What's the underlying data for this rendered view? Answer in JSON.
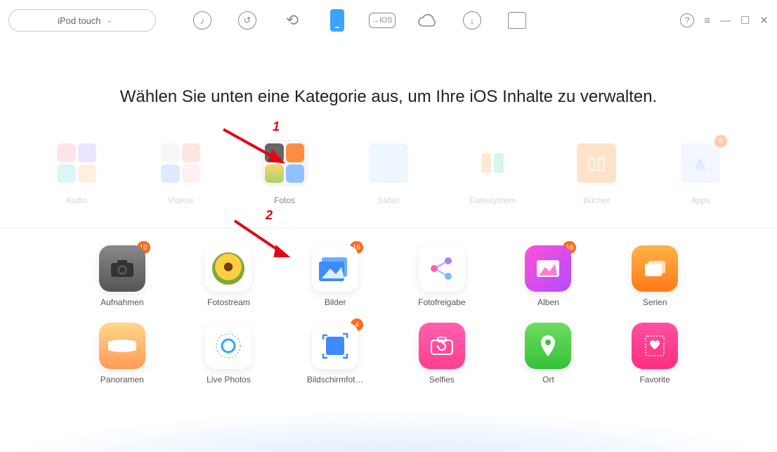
{
  "device": {
    "name": "iPod touch"
  },
  "heading": "Wählen Sie unten eine Kategorie aus, um Ihre iOS Inhalte zu verwalten.",
  "categories": [
    {
      "label": "Audio"
    },
    {
      "label": "Videos"
    },
    {
      "label": "Fotos",
      "selected": true
    },
    {
      "label": "Safari"
    },
    {
      "label": "Dateisystem"
    },
    {
      "label": "Bücher"
    },
    {
      "label": "Apps",
      "badge": "5"
    }
  ],
  "subs": [
    {
      "label": "Aufnahmen",
      "badge": "10"
    },
    {
      "label": "Fotostream"
    },
    {
      "label": "Bilder",
      "badge": "16"
    },
    {
      "label": "Fotofreigabe"
    },
    {
      "label": "Alben",
      "badge": "16"
    },
    {
      "label": "Serien"
    },
    {
      "label": "Panoramen"
    },
    {
      "label": "Live Photos"
    },
    {
      "label": "Bildschirmfot…",
      "badge": "4"
    },
    {
      "label": "Selfies"
    },
    {
      "label": "Ort"
    },
    {
      "label": "Favorite"
    }
  ],
  "annotations": {
    "one": "1",
    "two": "2"
  }
}
